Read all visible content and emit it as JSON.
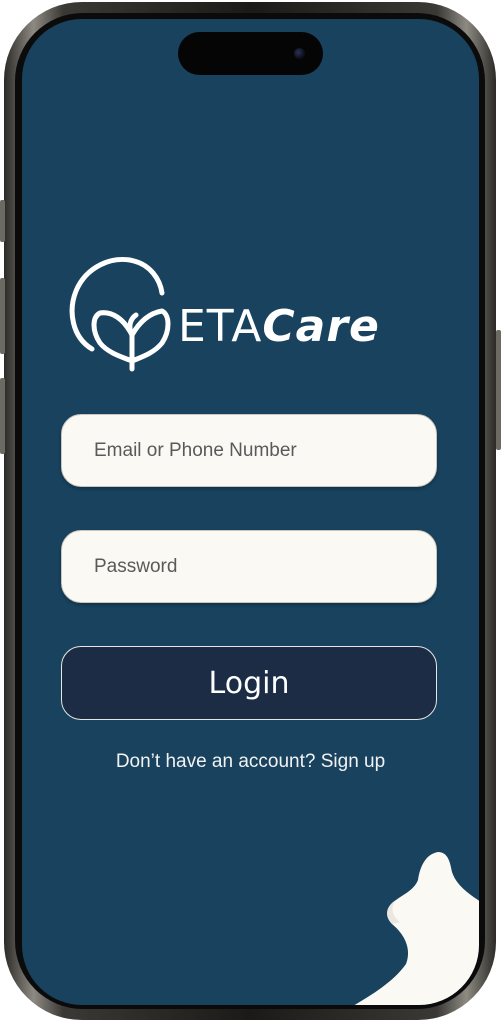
{
  "app": {
    "brand": {
      "part1": "ETA",
      "part2": "Care"
    }
  },
  "form": {
    "email_placeholder": "Email or Phone Number",
    "password_placeholder": "Password",
    "login_label": "Login",
    "signup_prompt": "Don’t have an account?",
    "signup_link": "Sign up"
  },
  "icons": {
    "logo": "heart-leaf-logo-icon",
    "camera": "camera-icon"
  },
  "colors": {
    "background": "#18425e",
    "field_bg": "#fbf9f3",
    "button_bg": "#1b2c44",
    "text_light": "#ffffff",
    "blob": "#fbf9f3"
  }
}
